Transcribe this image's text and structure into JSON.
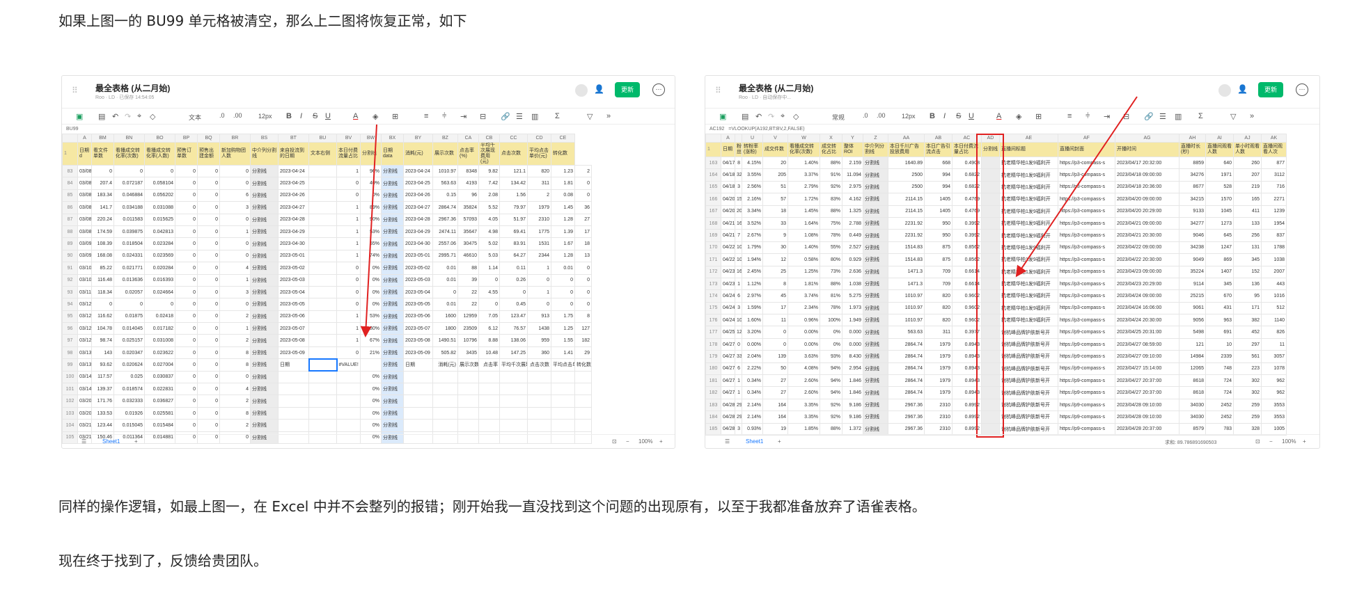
{
  "paragraphs": {
    "p1": "如果上图一的 BU99 单元格被清空，那么上二图将恢复正常，如下",
    "p2": "同样的操作逻辑，如最上图一，在 Excel 中并不会整列的报错；刚开始我一直没找到这个问题的出现原有，以至于我都准备放弃了语雀表格。",
    "p3": "现在终于找到了，反馈给贵团队。"
  },
  "left": {
    "title": "最全表格 (从二月始)",
    "meta": "Roo · LD · 已保存 14:54:05",
    "update_btn": "更新",
    "cellref": "BU99",
    "font_size": "12px",
    "text_mode": "文本",
    "sheet_tab": "Sheet1",
    "zoom": "100%",
    "cols": [
      "",
      "A",
      "BM",
      "BN",
      "BO",
      "BP",
      "BQ",
      "BR",
      "BS",
      "BT",
      "BU",
      "BV",
      "BW",
      "BX",
      "BY",
      "BZ",
      "CA",
      "CB",
      "CC",
      "CD",
      "CE"
    ],
    "headers": [
      "1",
      "日期 d",
      "看文件单数",
      "看播成交转化率(次数)",
      "看播成交转化率(人数)",
      "预售订单数",
      "预售出建金额",
      "新加购物团人数",
      "中介列分割线",
      "来自投流到的日期",
      "文本右侧",
      "本日付费流量占比",
      "分割线",
      "日期 data",
      "消耗(元)",
      "展示次数",
      "点击率(%)",
      "平均千次展现费用(元)",
      "点击次数",
      "平均点击单价(元)",
      "转化数"
    ],
    "rows": [
      [
        "83",
        "03/08",
        "0",
        "0",
        "0",
        "0",
        "0",
        "0",
        "分割线",
        "2023-04-24",
        "",
        "1",
        "96%",
        "分割线",
        "2023-04-24",
        "1010.97",
        "8348",
        "9.82",
        "121.1",
        "820",
        "1.23",
        "2"
      ],
      [
        "84",
        "03/08",
        "207.4",
        "0.072187",
        "0.058104",
        "0",
        "0",
        "0",
        "分割线",
        "2023-04-25",
        "",
        "0",
        "40%",
        "分割线",
        "2023-04-25",
        "563.63",
        "4193",
        "7.42",
        "134.42",
        "311",
        "1.81",
        "0"
      ],
      [
        "85",
        "03/08",
        "183.34",
        "0.046884",
        "0.056202",
        "0",
        "0",
        "6",
        "分割线",
        "2023-04-26",
        "",
        "0",
        "0%",
        "分割线",
        "2023-04-26",
        "0.15",
        "96",
        "2.08",
        "1.56",
        "2",
        "0.08",
        "0"
      ],
      [
        "86",
        "03/08",
        "141.7",
        "0.034188",
        "0.031088",
        "0",
        "0",
        "3",
        "分割线",
        "2023-04-27",
        "",
        "1",
        "89%",
        "分割线",
        "2023-04-27",
        "2864.74",
        "35824",
        "5.52",
        "79.97",
        "1979",
        "1.45",
        "36"
      ],
      [
        "87",
        "03/08",
        "220.24",
        "0.011583",
        "0.015625",
        "0",
        "0",
        "0",
        "分割线",
        "2023-04-28",
        "",
        "1",
        "90%",
        "分割线",
        "2023-04-28",
        "2967.36",
        "57093",
        "4.05",
        "51.97",
        "2310",
        "1.28",
        "27"
      ],
      [
        "88",
        "03/08",
        "174.59",
        "0.039875",
        "0.042813",
        "0",
        "0",
        "1",
        "分割线",
        "2023-04-29",
        "",
        "1",
        "53%",
        "分割线",
        "2023-04-29",
        "2474.11",
        "35647",
        "4.98",
        "69.41",
        "1775",
        "1.39",
        "17"
      ],
      [
        "89",
        "03/09",
        "108.39",
        "0.018504",
        "0.023284",
        "0",
        "0",
        "0",
        "分割线",
        "2023-04-30",
        "",
        "1",
        "55%",
        "分割线",
        "2023-04-30",
        "2557.06",
        "30475",
        "5.02",
        "83.91",
        "1531",
        "1.67",
        "18"
      ],
      [
        "90",
        "03/09",
        "168.08",
        "0.024331",
        "0.023569",
        "0",
        "0",
        "0",
        "分割线",
        "2023-05-01",
        "",
        "1",
        "74%",
        "分割线",
        "2023-05-01",
        "2995.71",
        "46610",
        "5.03",
        "64.27",
        "2344",
        "1.28",
        "13"
      ],
      [
        "91",
        "03/10",
        "85.22",
        "0.021771",
        "0.020284",
        "0",
        "0",
        "4",
        "分割线",
        "2023-05-02",
        "",
        "0",
        "0%",
        "分割线",
        "2023-05-02",
        "0.01",
        "88",
        "1.14",
        "0.11",
        "1",
        "0.01",
        "0"
      ],
      [
        "92",
        "03/10",
        "116.48",
        "0.013636",
        "0.016393",
        "0",
        "0",
        "1",
        "分割线",
        "2023-05-03",
        "",
        "0",
        "0%",
        "分割线",
        "2023-05-03",
        "0.01",
        "39",
        "0",
        "0.26",
        "0",
        "0",
        "0"
      ],
      [
        "93",
        "03/11",
        "118.34",
        "0.02057",
        "0.024664",
        "0",
        "0",
        "3",
        "分割线",
        "2023-05-04",
        "",
        "0",
        "0%",
        "分割线",
        "2023-05-04",
        "0",
        "22",
        "4.55",
        "0",
        "1",
        "0",
        "0"
      ],
      [
        "94",
        "03/12",
        "0",
        "0",
        "0",
        "0",
        "0",
        "0",
        "分割线",
        "2023-05-05",
        "",
        "0",
        "0%",
        "分割线",
        "2023-05-05",
        "0.01",
        "22",
        "0",
        "0.45",
        "0",
        "0",
        "0"
      ],
      [
        "95",
        "03/12",
        "116.62",
        "0.01875",
        "0.02418",
        "0",
        "0",
        "2",
        "分割线",
        "2023-05-06",
        "",
        "1",
        "53%",
        "分割线",
        "2023-05-06",
        "1600",
        "12959",
        "7.05",
        "123.47",
        "913",
        "1.75",
        "8"
      ],
      [
        "96",
        "03/12",
        "104.78",
        "0.014045",
        "0.017182",
        "0",
        "0",
        "1",
        "分割线",
        "2023-05-07",
        "",
        "1",
        "80%",
        "分割线",
        "2023-05-07",
        "1800",
        "23509",
        "6.12",
        "76.57",
        "1438",
        "1.25",
        "127"
      ],
      [
        "97",
        "03/12",
        "98.74",
        "0.025157",
        "0.031008",
        "0",
        "0",
        "2",
        "分割线",
        "2023-05-08",
        "",
        "1",
        "67%",
        "分割线",
        "2023-05-08",
        "1490.51",
        "10796",
        "8.88",
        "138.06",
        "959",
        "1.55",
        "182"
      ],
      [
        "98",
        "03/13",
        "143",
        "0.020347",
        "0.023622",
        "0",
        "0",
        "8",
        "分割线",
        "2023-05-09",
        "",
        "0",
        "21%",
        "分割线",
        "2023-05-09",
        "505.82",
        "3435",
        "10.48",
        "147.25",
        "360",
        "1.41",
        "29"
      ],
      [
        "99",
        "03/13",
        "93.62",
        "0.020624",
        "0.027004",
        "0",
        "0",
        "8",
        "分割线",
        "日期",
        "",
        "#VALUE!",
        "",
        "分割线",
        "日期",
        "消耗(元)",
        "展示次数",
        "点击率",
        "平均千次展现",
        "点击次数",
        "平均点击单",
        "转化数"
      ],
      [
        "100",
        "03/14",
        "117.57",
        "0.025",
        "0.030837",
        "0",
        "0",
        "0",
        "分割线",
        "",
        "",
        "",
        "0%",
        "分割线",
        "",
        "",
        "",
        "",
        "",
        "",
        "",
        ""
      ],
      [
        "101",
        "03/14",
        "139.37",
        "0.018574",
        "0.022831",
        "0",
        "0",
        "4",
        "分割线",
        "",
        "",
        "",
        "0%",
        "分割线",
        "",
        "",
        "",
        "",
        "",
        "",
        "",
        ""
      ],
      [
        "102",
        "03/20",
        "171.76",
        "0.032333",
        "0.036827",
        "0",
        "0",
        "2",
        "分割线",
        "",
        "",
        "",
        "0%",
        "分割线",
        "",
        "",
        "",
        "",
        "",
        "",
        "",
        ""
      ],
      [
        "103",
        "03/20",
        "133.53",
        "0.01926",
        "0.025581",
        "0",
        "0",
        "8",
        "分割线",
        "",
        "",
        "",
        "0%",
        "分割线",
        "",
        "",
        "",
        "",
        "",
        "",
        "",
        ""
      ],
      [
        "104",
        "03/21",
        "123.44",
        "0.015045",
        "0.015484",
        "0",
        "0",
        "2",
        "分割线",
        "",
        "",
        "",
        "0%",
        "分割线",
        "",
        "",
        "",
        "",
        "",
        "",
        "",
        ""
      ],
      [
        "105",
        "03/21",
        "150.46",
        "0.011364",
        "0.014881",
        "0",
        "0",
        "0",
        "分割线",
        "",
        "",
        "",
        "0%",
        "分割线",
        "",
        "",
        "",
        "",
        "",
        "",
        "",
        ""
      ]
    ]
  },
  "right": {
    "title": "最全表格 (从二月始)",
    "meta": "Roo · LD · 自动保存中...",
    "update_btn": "更新",
    "cellref": "AC192",
    "formula": "=VLOOKUP(A192,BT:BV,2,FALSE)",
    "font_size": "12px",
    "text_mode": "常规",
    "sheet_tab": "Sheet1",
    "zoom": "100%",
    "sum_text": "求和: 89.786891690503",
    "cols": [
      "",
      "A",
      "",
      "U",
      "V",
      "W",
      "X",
      "Y",
      "Z",
      "AA",
      "AB",
      "AC",
      "AD",
      "AE",
      "AF",
      "AG",
      "AH",
      "AI",
      "AJ",
      "AK"
    ],
    "headers": [
      "1",
      "日期",
      "粉丝",
      "转粉率(涨粉)",
      "成交件数",
      "看播成交转化率(次数)",
      "成交转化占比",
      "整体ROI",
      "中介列分割线",
      "本日千川广告投放费用",
      "本日广告引流点击",
      "本日付费流量占比",
      "分割线",
      "直播间标题",
      "直播间封面",
      "开播时间",
      "直播时长(秒)",
      "直播间观看人数",
      "单小时观看人数",
      "直播间观看人次"
    ],
    "rows": [
      [
        "163",
        "04/17",
        "8",
        "4.15%",
        "20",
        "1.40%",
        "88%",
        "2.159",
        "分割线",
        "1640.89",
        "668",
        "0.4908",
        "",
        "抗老精华柏1发9福利开",
        "https://p3-compass-s",
        "2023/04/17 20:32:00",
        "8859",
        "640",
        "260",
        "877"
      ],
      [
        "164",
        "04/18",
        "32",
        "3.55%",
        "205",
        "3.37%",
        "91%",
        "11.094",
        "分割线",
        "2500",
        "994",
        "0.6822",
        "",
        "抗老精华柏1发9福利开",
        "https://p3-compass-s",
        "2023/04/18 09:00:00",
        "34276",
        "1971",
        "207",
        "3112"
      ],
      [
        "165",
        "04/18",
        "3",
        "2.56%",
        "51",
        "2.79%",
        "92%",
        "2.975",
        "分割线",
        "2500",
        "994",
        "0.6822",
        "",
        "抗老精华柏1发9福利开",
        "https://p3-compass-s",
        "2023/04/18 20:36:00",
        "8677",
        "528",
        "219",
        "716"
      ],
      [
        "166",
        "04/20",
        "15",
        "2.16%",
        "57",
        "1.72%",
        "83%",
        "4.162",
        "分割线",
        "2114.15",
        "1405",
        "0.4769",
        "",
        "抗老精华柏1发9福利开",
        "https://p3-compass-s",
        "2023/04/20 09:00:00",
        "34215",
        "1570",
        "165",
        "2271"
      ],
      [
        "167",
        "04/20",
        "20",
        "3.34%",
        "18",
        "1.45%",
        "88%",
        "1.325",
        "分割线",
        "2114.15",
        "1405",
        "0.4769",
        "",
        "抗老精华柏1发9福利开",
        "https://p3-compass-s",
        "2023/04/20 20:29:00",
        "9133",
        "1045",
        "411",
        "1239"
      ],
      [
        "168",
        "04/21",
        "16",
        "3.52%",
        "33",
        "1.64%",
        "75%",
        "2.788",
        "分割线",
        "2231.92",
        "950",
        "0.3992",
        "",
        "抗老精华柏1发9福利开",
        "https://p3-compass-s",
        "2023/04/21 09:00:00",
        "34277",
        "1273",
        "133",
        "1954"
      ],
      [
        "169",
        "04/21",
        "7",
        "2.67%",
        "9",
        "1.08%",
        "78%",
        "0.449",
        "分割线",
        "2231.92",
        "950",
        "0.3992",
        "",
        "抗老精华柏1发9福利开",
        "https://p3-compass-s",
        "2023/04/21 20:30:00",
        "9046",
        "645",
        "256",
        "837"
      ],
      [
        "170",
        "04/22",
        "10",
        "1.79%",
        "30",
        "1.40%",
        "55%",
        "2.527",
        "分割线",
        "1514.83",
        "875",
        "0.8562",
        "",
        "抗老精华柏1发9福利开",
        "https://p3-compass-s",
        "2023/04/22 09:00:00",
        "34238",
        "1247",
        "131",
        "1788"
      ],
      [
        "171",
        "04/22",
        "10",
        "1.94%",
        "12",
        "0.58%",
        "80%",
        "0.929",
        "分割线",
        "1514.83",
        "875",
        "0.8562",
        "",
        "抗老精华柏1发9福利开",
        "https://p3-compass-s",
        "2023/04/22 20:30:00",
        "9049",
        "869",
        "345",
        "1038"
      ],
      [
        "172",
        "04/23",
        "16",
        "2.45%",
        "25",
        "1.25%",
        "73%",
        "2.636",
        "分割线",
        "1471.3",
        "709",
        "0.6614",
        "",
        "抗老精华柏1发9福利开",
        "https://p3-compass-s",
        "2023/04/23 09:00:00",
        "35224",
        "1407",
        "152",
        "2007"
      ],
      [
        "173",
        "04/23",
        "1",
        "1.12%",
        "8",
        "1.81%",
        "88%",
        "1.038",
        "分割线",
        "1471.3",
        "709",
        "0.6614",
        "",
        "抗老精华柏1发9福利开",
        "https://p3-compass-s",
        "2023/04/23 20:29:00",
        "9114",
        "345",
        "136",
        "443"
      ],
      [
        "174",
        "04/24",
        "6",
        "2.97%",
        "45",
        "3.74%",
        "81%",
        "5.275",
        "分割线",
        "1010.97",
        "820",
        "0.9602",
        "",
        "抗老精华柏1发9福利开",
        "https://p3-compass-s",
        "2023/04/24 09:00:00",
        "25215",
        "670",
        "95",
        "1016"
      ],
      [
        "175",
        "04/24",
        "3",
        "1.59%",
        "17",
        "2.34%",
        "78%",
        "1.973",
        "分割线",
        "1010.97",
        "820",
        "0.9602",
        "",
        "抗老精华柏1发9福利开",
        "https://p3-compass-s",
        "2023/04/24 16:06:00",
        "9061",
        "431",
        "171",
        "512"
      ],
      [
        "176",
        "04/24",
        "10",
        "1.60%",
        "11",
        "0.96%",
        "100%",
        "1.949",
        "分割线",
        "1010.97",
        "820",
        "0.9602",
        "",
        "抗老精华柏1发9福利开",
        "https://p3-compass-s",
        "2023/04/24 20:30:00",
        "9056",
        "963",
        "382",
        "1140"
      ],
      [
        "177",
        "04/25",
        "12",
        "3.20%",
        "0",
        "0.00%",
        "0%",
        "0.000",
        "分割线",
        "563.63",
        "311",
        "0.3977",
        "",
        "谢杭峰品牌护肤新号开",
        "https://p9-compass-s",
        "2023/04/25 20:31:00",
        "5498",
        "691",
        "452",
        "826"
      ],
      [
        "178",
        "04/27",
        "0",
        "0.00%",
        "0",
        "0.00%",
        "0%",
        "0.000",
        "分割线",
        "2864.74",
        "1979",
        "0.8943",
        "",
        "谢杭峰品牌护肤新号开",
        "https://p9-compass-s",
        "2023/04/27 08:59:00",
        "121",
        "10",
        "297",
        "11"
      ],
      [
        "179",
        "04/27",
        "33",
        "2.04%",
        "139",
        "3.63%",
        "93%",
        "8.430",
        "分割线",
        "2864.74",
        "1979",
        "0.8943",
        "",
        "谢杭峰品牌护肤新号开",
        "https://p9-compass-s",
        "2023/04/27 09:10:00",
        "14984",
        "2339",
        "561",
        "3057"
      ],
      [
        "180",
        "04/27",
        "6",
        "2.22%",
        "50",
        "4.08%",
        "94%",
        "2.954",
        "分割线",
        "2864.74",
        "1979",
        "0.8943",
        "",
        "谢杭峰品牌护肤新号开",
        "https://p9-compass-s",
        "2023/04/27 15:14:00",
        "12065",
        "748",
        "223",
        "1078"
      ],
      [
        "181",
        "04/27",
        "1",
        "0.34%",
        "27",
        "2.60%",
        "94%",
        "1.846",
        "分割线",
        "2864.74",
        "1979",
        "0.8943",
        "",
        "谢杭峰品牌护肤新号开",
        "https://p9-compass-s",
        "2023/04/27 20:37:00",
        "8618",
        "724",
        "302",
        "962"
      ],
      [
        "182",
        "04/27",
        "1",
        "0.34%",
        "27",
        "2.60%",
        "94%",
        "1.846",
        "分割线",
        "2864.74",
        "1979",
        "0.8943",
        "",
        "谢杭峰品牌护肤新号开",
        "https://p9-compass-s",
        "2023/04/27 20:37:00",
        "8618",
        "724",
        "302",
        "962"
      ],
      [
        "183",
        "04/28",
        "29",
        "2.14%",
        "164",
        "3.35%",
        "92%",
        "9.186",
        "分割线",
        "2967.36",
        "2310",
        "0.8992",
        "",
        "谢杭峰品牌护肤新号开",
        "https://p9-compass-s",
        "2023/04/28 09:10:00",
        "34030",
        "2452",
        "259",
        "3553"
      ],
      [
        "184",
        "04/28",
        "29",
        "2.14%",
        "164",
        "3.35%",
        "92%",
        "9.186",
        "分割线",
        "2967.36",
        "2310",
        "0.8992",
        "",
        "谢杭峰品牌护肤新号开",
        "https://p9-compass-s",
        "2023/04/28 09:10:00",
        "34030",
        "2452",
        "259",
        "3553"
      ],
      [
        "185",
        "04/28",
        "3",
        "0.93%",
        "19",
        "1.85%",
        "88%",
        "1.372",
        "分割线",
        "2967.36",
        "2310",
        "0.8992",
        "",
        "谢杭峰品牌护肤新号开",
        "https://p9-compass-s",
        "2023/04/28 20:37:00",
        "8579",
        "783",
        "328",
        "1005"
      ]
    ]
  }
}
